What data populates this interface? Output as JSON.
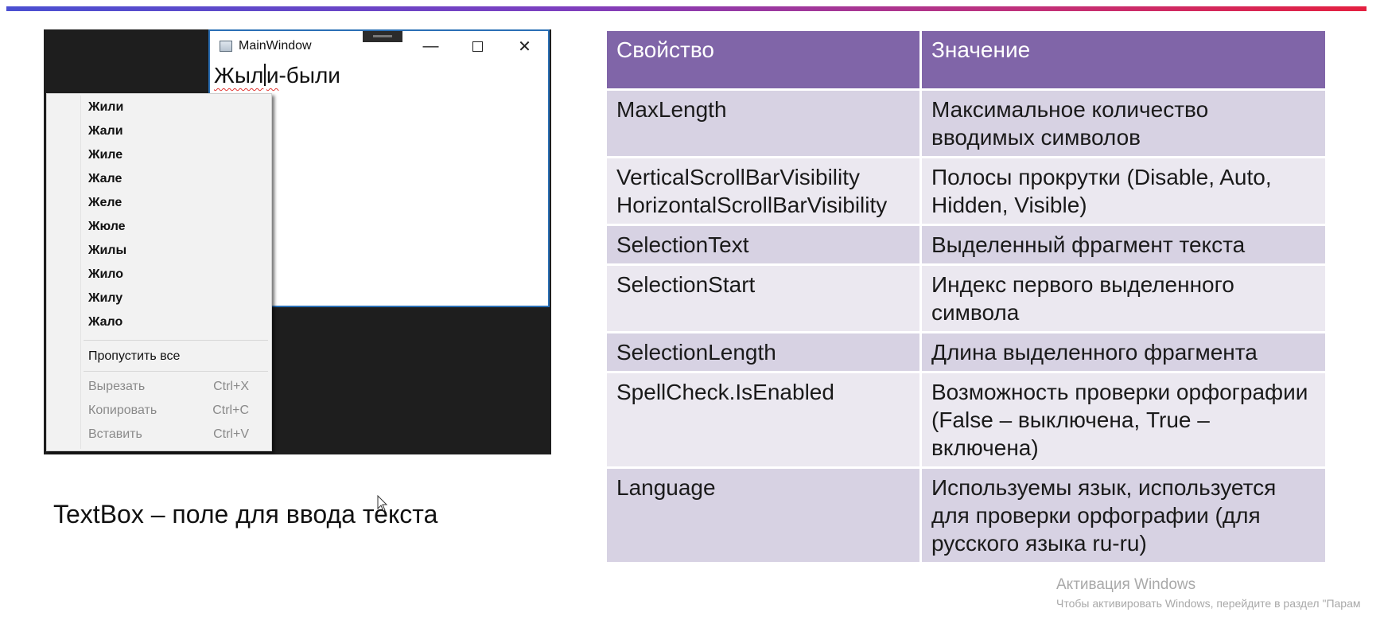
{
  "screenshot": {
    "window_title": "MainWindow",
    "controls": {
      "minimize": "—",
      "close": "✕"
    },
    "textbox": {
      "before_caret": "Жыл",
      "after_caret": "и",
      "rest": "-были"
    },
    "context_menu": {
      "suggestions": [
        "Жили",
        "Жали",
        "Жиле",
        "Жале",
        "Желе",
        "Жюле",
        "Жилы",
        "Жило",
        "Жилу",
        "Жало"
      ],
      "ignore_all": "Пропустить все",
      "cut": {
        "label": "Вырезать",
        "shortcut": "Ctrl+X"
      },
      "copy": {
        "label": "Копировать",
        "shortcut": "Ctrl+C"
      },
      "paste": {
        "label": "Вставить",
        "shortcut": "Ctrl+V"
      }
    }
  },
  "caption": "TextBox – поле для ввода текста",
  "table": {
    "headers": [
      "Свойство",
      "Значение"
    ],
    "rows": [
      {
        "prop": "MaxLength",
        "value": "Максимальное количество вводимых символов"
      },
      {
        "prop": "VerticalScrollBarVisibility HorizontalScrollBarVisibility",
        "value": "Полосы прокрутки (Disable, Auto, Hidden, Visible)"
      },
      {
        "prop": "SelectionText",
        "value": "Выделенный фрагмент текста"
      },
      {
        "prop": "SelectionStart",
        "value": "Индекс первого выделенного символа"
      },
      {
        "prop": "SelectionLength",
        "value": "Длина выделенного фрагмента"
      },
      {
        "prop": "SpellCheck.IsEnabled",
        "value": "Возможность проверки орфографии (False – выключена, True – включена)"
      },
      {
        "prop": "Language",
        "value": "Используемы язык, используется для проверки орфографии (для русского языка ru-ru)"
      }
    ]
  },
  "watermark": {
    "title": "Активация Windows",
    "subtitle": "Чтобы активировать Windows, перейдите в раздел \"Парам"
  },
  "colors": {
    "header_bg": "#8065a8",
    "row_odd": "#d7d2e3",
    "row_even": "#ebe8f0",
    "window_border": "#2a6fb5"
  }
}
